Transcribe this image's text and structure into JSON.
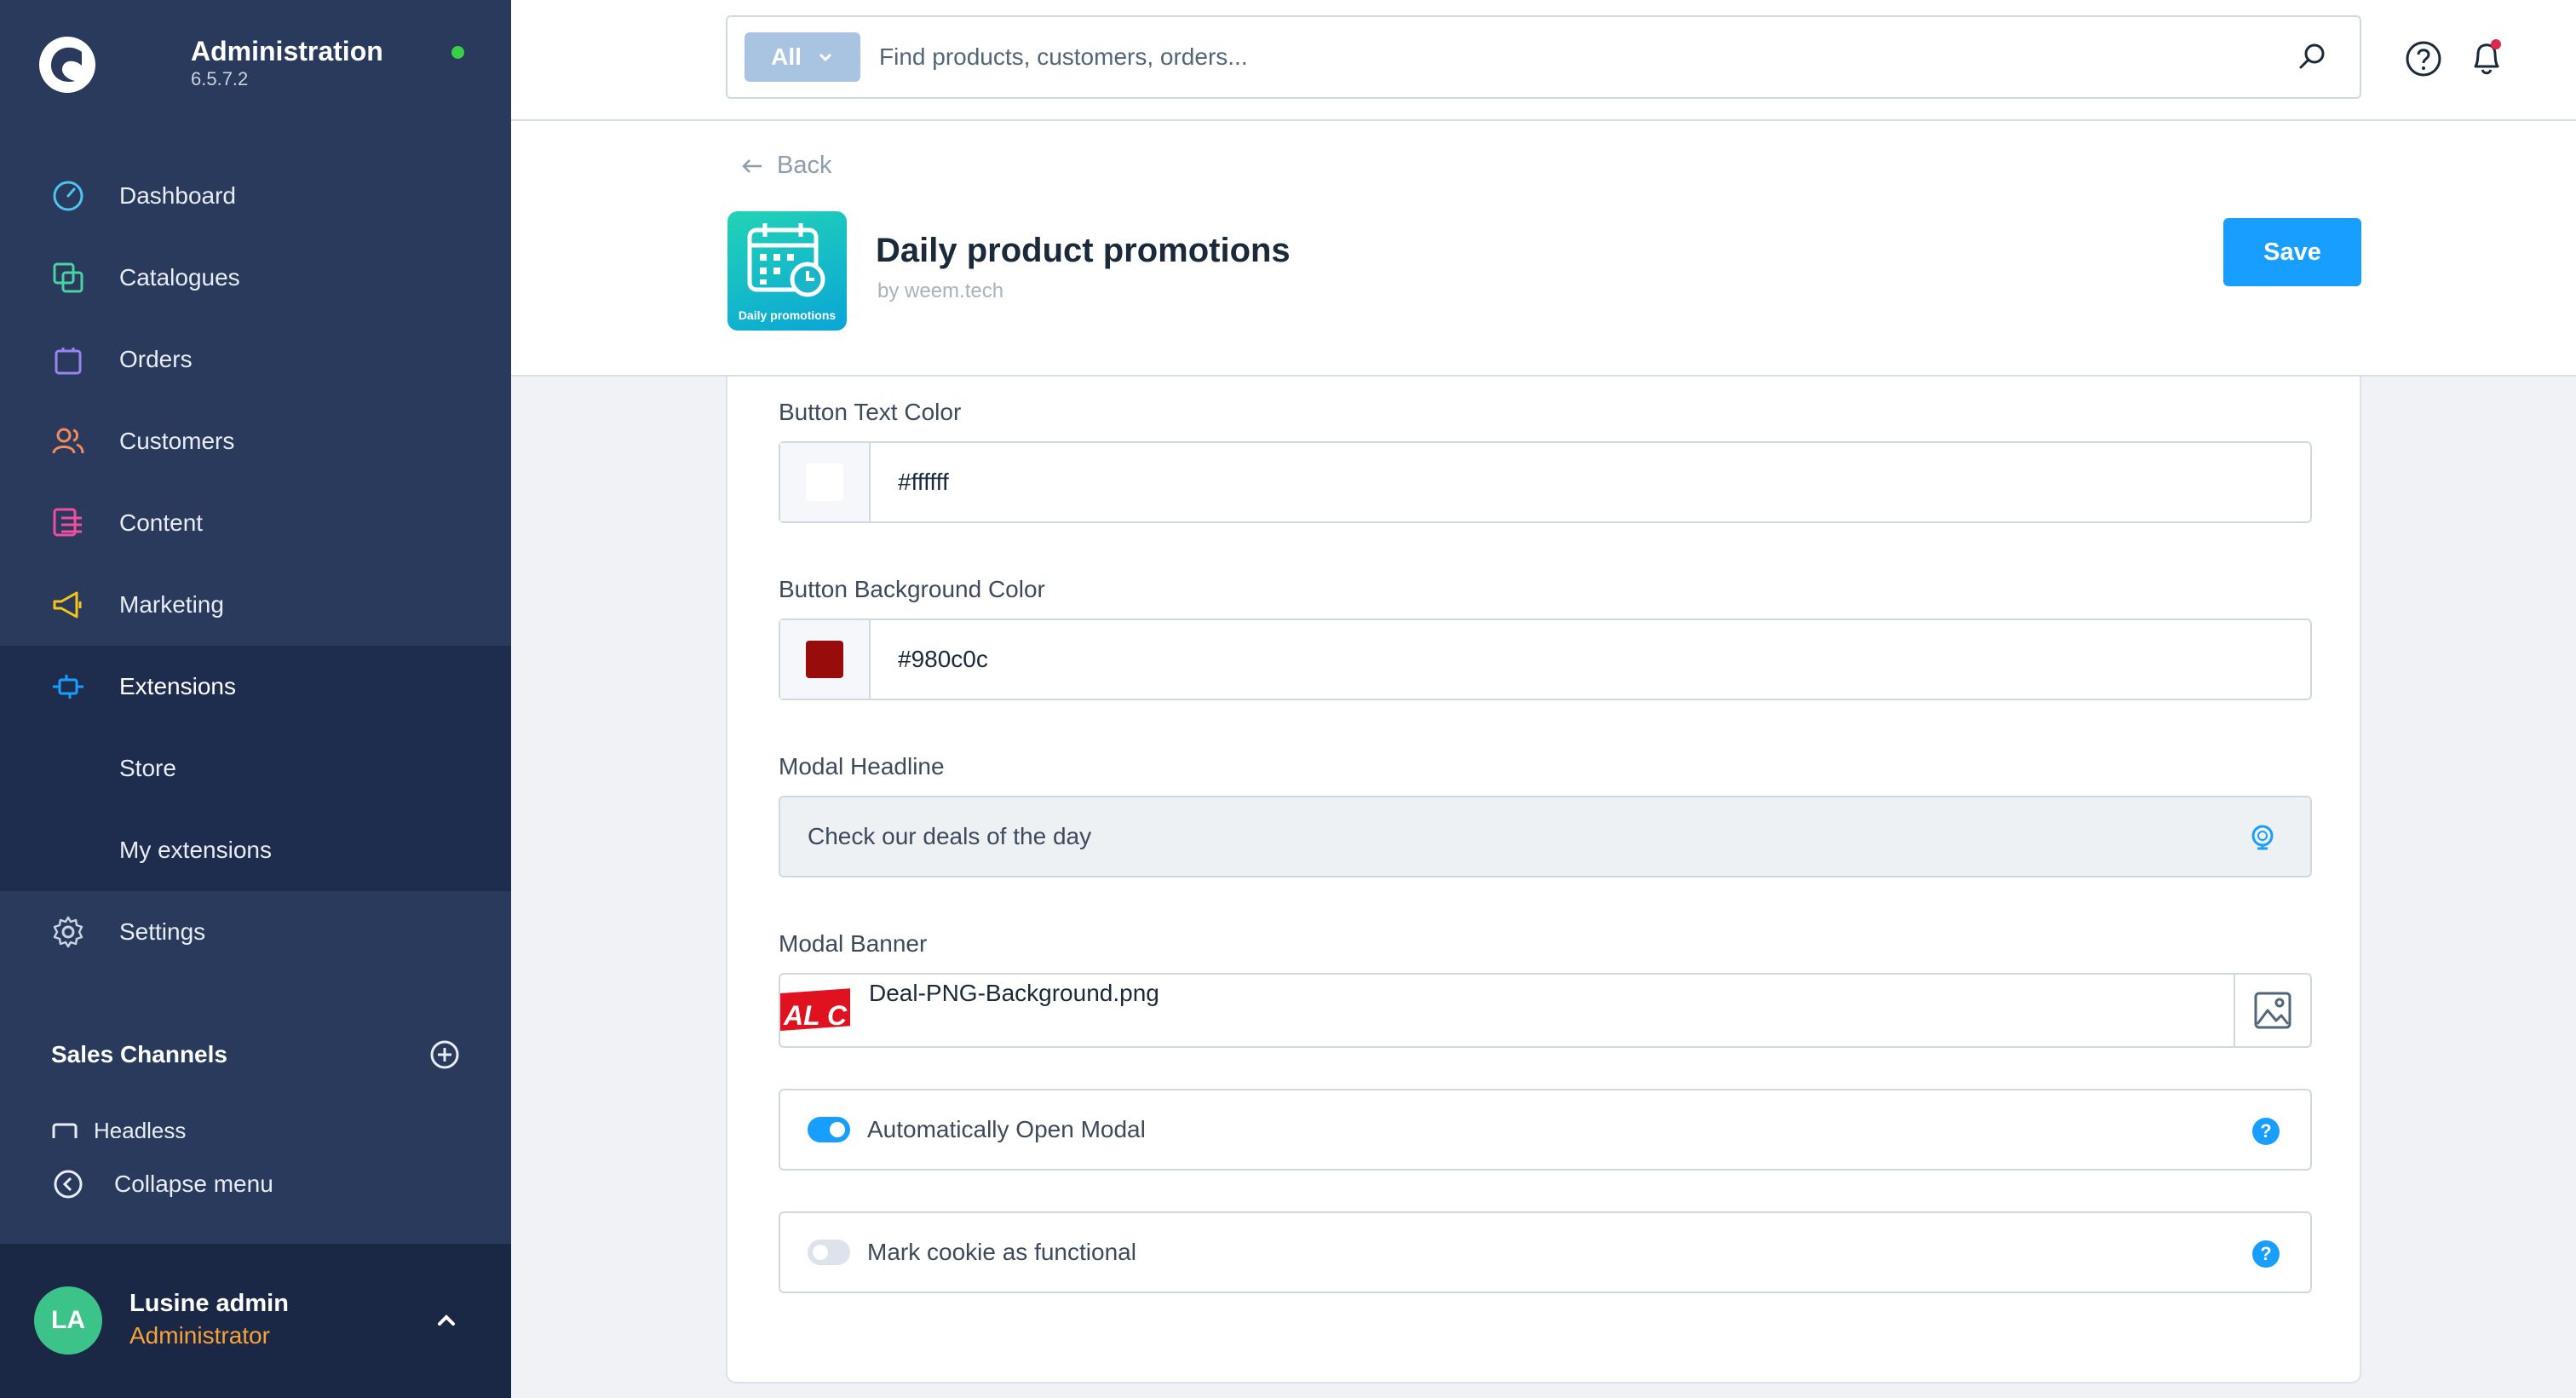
{
  "app": {
    "title": "Administration",
    "version": "6.5.7.2",
    "status_color": "#37d046"
  },
  "sidebar": {
    "items": [
      {
        "label": "Dashboard",
        "icon": "gauge-icon",
        "color": "#4ec3f0"
      },
      {
        "label": "Catalogues",
        "icon": "stack-icon",
        "color": "#4bd2a2"
      },
      {
        "label": "Orders",
        "icon": "shopping-bag-icon",
        "color": "#9a84f0"
      },
      {
        "label": "Customers",
        "icon": "users-icon",
        "color": "#f38b5c"
      },
      {
        "label": "Content",
        "icon": "content-list-icon",
        "color": "#f04fa0"
      },
      {
        "label": "Marketing",
        "icon": "megaphone-icon",
        "color": "#f5c518"
      },
      {
        "label": "Extensions",
        "icon": "plug-icon",
        "color": "#189eff",
        "active": true
      },
      {
        "label": "Store"
      },
      {
        "label": "My extensions"
      },
      {
        "label": "Settings",
        "icon": "gear-icon",
        "color": "#c9d2e0"
      }
    ],
    "sales_channels_title": "Sales Channels",
    "channel_peek": "Headless",
    "collapse_label": "Collapse menu"
  },
  "user": {
    "initials": "LA",
    "name": "Lusine admin",
    "role": "Administrator"
  },
  "search": {
    "type_label": "All",
    "placeholder": "Find products, customers, orders..."
  },
  "header": {
    "back_label": "Back",
    "app_name": "Daily product promotions",
    "vendor": "by weem.tech",
    "icon_caption": "Daily promotions",
    "save_label": "Save"
  },
  "form": {
    "button_text_color": {
      "label": "Button Text Color",
      "value": "#ffffff"
    },
    "button_bg_color": {
      "label": "Button Background Color",
      "value": "#980c0c"
    },
    "modal_headline": {
      "label": "Modal Headline",
      "value": "Check our deals of the day"
    },
    "modal_banner": {
      "label": "Modal Banner",
      "file": "Deal-PNG-Background.png",
      "thumb_text": "AL C"
    },
    "auto_open": {
      "label": "Automatically Open Modal",
      "on": true
    },
    "cookie_functional": {
      "label": "Mark cookie as functional",
      "on": false
    }
  },
  "colors": {
    "accent": "#189eff",
    "sidebar_bg": "#2a3a5c",
    "role_color": "#f7a23a"
  }
}
